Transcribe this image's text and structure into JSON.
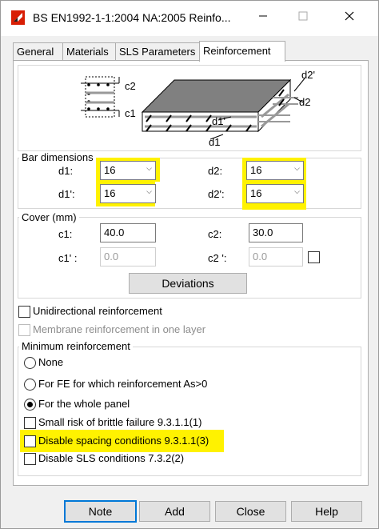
{
  "window": {
    "title": "BS EN1992-1-1:2004 NA:2005 Reinfo...",
    "minimize_icon": "minimize-icon",
    "maximize_icon": "maximize-icon",
    "close_icon": "close-icon"
  },
  "tabs": [
    {
      "label": "General"
    },
    {
      "label": "Materials"
    },
    {
      "label": "SLS Parameters"
    },
    {
      "label": "Reinforcement",
      "active": true
    }
  ],
  "diagram": {
    "labels": {
      "c2": "c2",
      "c1": "c1",
      "d2p": "d2'",
      "d2": "d2",
      "d1p": "d1'",
      "d1": "d1"
    }
  },
  "bar_dimensions": {
    "title": "Bar dimensions",
    "d1": {
      "label": "d1:",
      "value": "16"
    },
    "d2": {
      "label": "d2:",
      "value": "16"
    },
    "d1p": {
      "label": "d1':",
      "value": "16"
    },
    "d2p": {
      "label": "d2':",
      "value": "16"
    }
  },
  "cover": {
    "title": "Cover (mm)",
    "c1": {
      "label": "c1:",
      "value": "40.0"
    },
    "c2": {
      "label": "c2:",
      "value": "30.0"
    },
    "c1p": {
      "label": "c1' :",
      "value": "0.0"
    },
    "c2p": {
      "label": "c2 ':",
      "value": "0.0"
    },
    "deviations_label": "Deviations"
  },
  "options": {
    "unidirectional": {
      "label": "Unidirectional reinforcement",
      "checked": false
    },
    "membrane": {
      "label": "Membrane reinforcement in one layer",
      "checked": false,
      "disabled": true
    }
  },
  "minimum_reinforcement": {
    "title": "Minimum reinforcement",
    "radios": [
      {
        "label": "None",
        "selected": false
      },
      {
        "label": "For FE for which reinforcement As>0",
        "selected": false
      },
      {
        "label": "For the whole panel",
        "selected": true
      }
    ],
    "checks": [
      {
        "label": "Small risk of brittle failure  9.3.1.1(1)",
        "checked": false
      },
      {
        "label": "Disable spacing conditions 9.3.1.1(3)",
        "checked": false
      },
      {
        "label": "Disable SLS conditions 7.3.2(2)",
        "checked": false
      }
    ]
  },
  "highlight_color": "#fff200",
  "buttons": {
    "note": "Note",
    "add": "Add",
    "close": "Close",
    "help": "Help"
  }
}
